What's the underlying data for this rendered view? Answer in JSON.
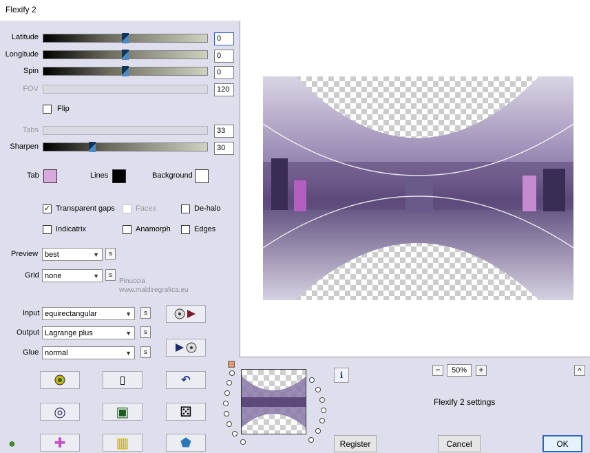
{
  "window": {
    "title": "Flexify 2"
  },
  "sliders": {
    "latitude": {
      "label": "Latitude",
      "value": "0",
      "level": 0.5
    },
    "longitude": {
      "label": "Longitude",
      "value": "0",
      "level": 0.5
    },
    "spin": {
      "label": "Spin",
      "value": "0",
      "level": 0.5
    },
    "fov": {
      "label": "FOV",
      "value": "120"
    },
    "tabs": {
      "label": "Tabs",
      "value": "33"
    },
    "sharpen": {
      "label": "Sharpen",
      "value": "30",
      "level": 0.3
    }
  },
  "flip": {
    "label": "Flip",
    "checked": false
  },
  "colors": {
    "tab": {
      "label": "Tab",
      "color": "#d9a8dc"
    },
    "lines": {
      "label": "Lines",
      "color": "#000000"
    },
    "background": {
      "label": "Background",
      "color": "#ffffff"
    }
  },
  "options": {
    "transparent_gaps": {
      "label": "Transparent gaps",
      "checked": true
    },
    "faces": {
      "label": "Faces",
      "checked": false,
      "disabled": true
    },
    "de_halo": {
      "label": "De-halo",
      "checked": false
    },
    "indicatrix": {
      "label": "Indicatrix",
      "checked": false
    },
    "anamorph": {
      "label": "Anamorph",
      "checked": false
    },
    "edges": {
      "label": "Edges",
      "checked": false
    }
  },
  "selects": {
    "preview": {
      "label": "Preview",
      "value": "best"
    },
    "grid": {
      "label": "Grid",
      "value": "none"
    },
    "input": {
      "label": "Input",
      "value": "equirectangular"
    },
    "output": {
      "label": "Output",
      "value": "Lagrange plus"
    },
    "glue": {
      "label": "Glue",
      "value": "normal"
    }
  },
  "small_button_label": "s",
  "watermark": {
    "line1": "Pinuccia",
    "line2": "www.maldiregrafica.eu"
  },
  "zoom": {
    "value": "50%",
    "minus": "−",
    "plus": "+"
  },
  "settings_name": "Flexify 2 settings",
  "buttons": {
    "register": "Register",
    "cancel": "Cancel",
    "ok": "OK"
  },
  "icons": {
    "info": "i",
    "scroll_up": "^",
    "checkmark": "✓",
    "dropdown": "▼",
    "new_doc": "▯",
    "undo": "↶",
    "target_ring": "◎",
    "square_frame": "▣",
    "dice": "⚄",
    "puzzle": "✚",
    "lego": "▦",
    "pentagon": "⬟",
    "frog": "●",
    "cube": "◆"
  },
  "accent": "#2b63c6",
  "preview_palette": {
    "purple": "#6a5a8a",
    "light": "#d8d4e4",
    "pink": "#d38ad6"
  }
}
